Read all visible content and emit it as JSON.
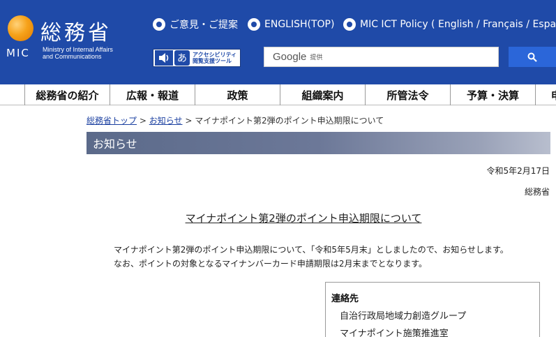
{
  "header": {
    "org_name": "総務省",
    "org_abbr": "MIC",
    "org_subtitle_1": "Ministry of Internal Affairs",
    "org_subtitle_2": "and Communications",
    "links": [
      {
        "label": "ご意見・ご提案"
      },
      {
        "label": "ENGLISH(TOP)"
      },
      {
        "label": "MIC ICT Policy ( English / Français / Español"
      }
    ],
    "accessibility": {
      "line1": "アクセシビリティ",
      "line2": "閲覧支援ツール",
      "icon2_char": "あ"
    },
    "search": {
      "brand": "Google",
      "provided": "提供"
    }
  },
  "nav": {
    "items": [
      {
        "label": "総務省の紹介"
      },
      {
        "label": "広報・報道"
      },
      {
        "label": "政策"
      },
      {
        "label": "組織案内"
      },
      {
        "label": "所管法令"
      },
      {
        "label": "予算・決算"
      },
      {
        "label": "申"
      }
    ]
  },
  "breadcrumb": {
    "home": "総務省トップ",
    "sep": ">",
    "section": "お知らせ",
    "current": "マイナポイント第2弾のポイント申込期限について"
  },
  "section_title": "お知らせ",
  "article": {
    "date": "令和5年2月17日",
    "issuer": "総務省",
    "title": "マイナポイント第2弾のポイント申込期限について",
    "paragraph_1": "マイナポイント第2弾のポイント申込期限について、「令和5年5月末」としましたので、お知らせします。",
    "paragraph_2": "なお、ポイントの対象となるマイナンバーカード申請期限は2月末までとなります。"
  },
  "contact": {
    "heading": "連絡先",
    "line_1": "自治行政局地域力創造グループ",
    "line_2": "マイナポイント施策推進室"
  },
  "colors": {
    "header_bg": "#1f4aa8",
    "search_button": "#2b66d9",
    "link": "#1a3fa0",
    "logo_orange": "#f6a21a"
  }
}
